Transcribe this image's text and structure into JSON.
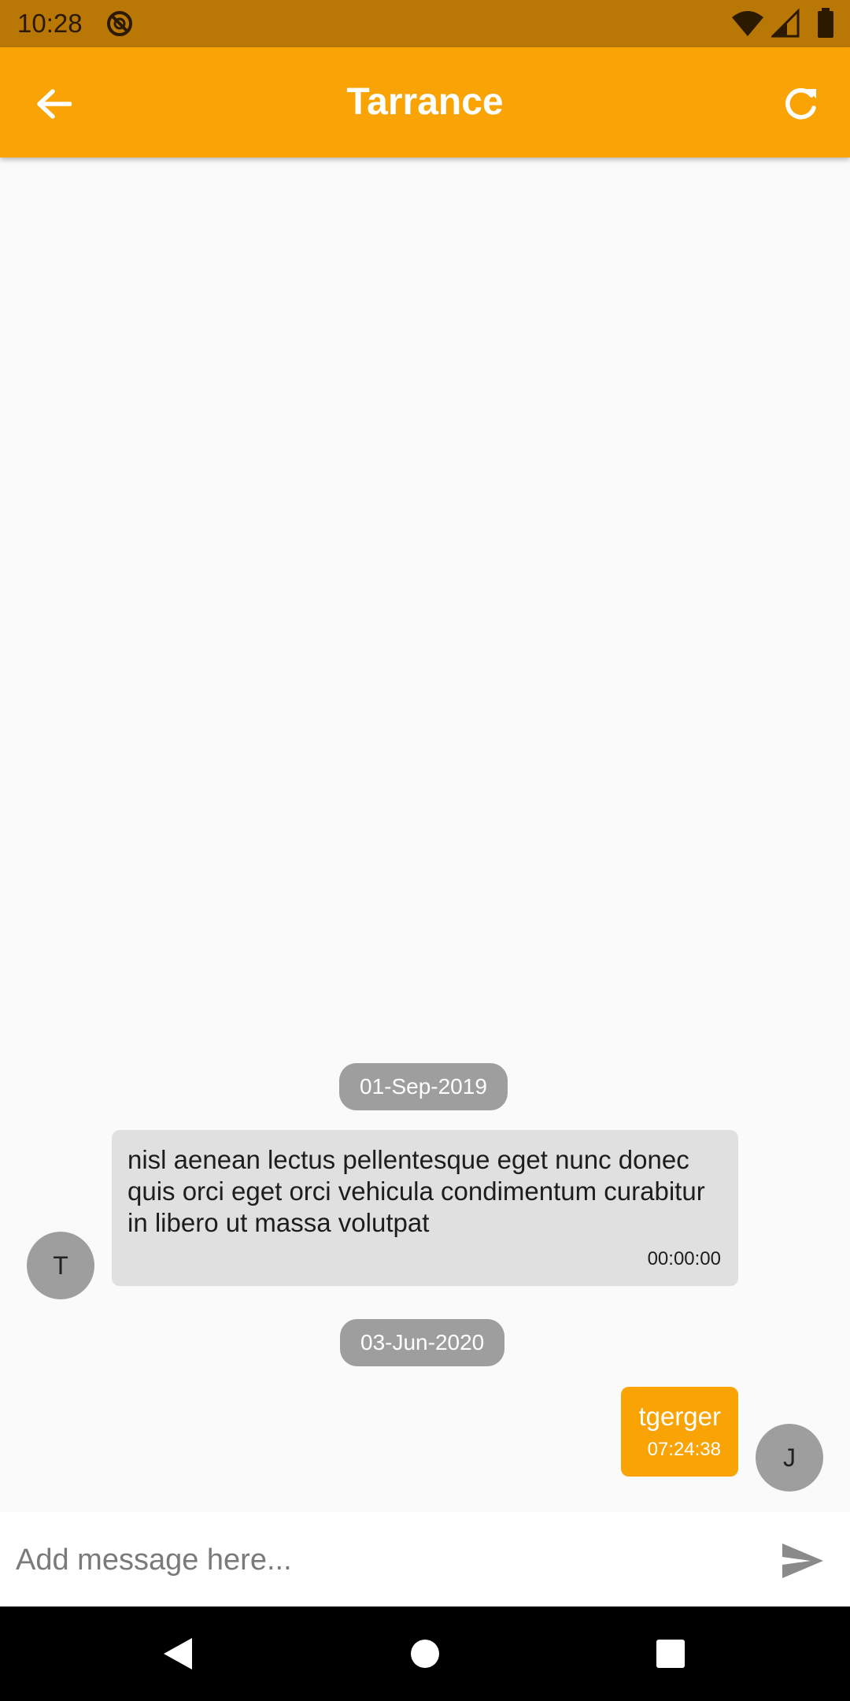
{
  "status_bar": {
    "time": "10:28",
    "icons": [
      "dnd-icon",
      "wifi-icon",
      "cellular-signal-icon",
      "battery-icon"
    ]
  },
  "app_bar": {
    "title": "Tarrance",
    "back_icon": "arrow-back-icon",
    "refresh_icon": "refresh-icon",
    "background": "#f9a305"
  },
  "messages": [
    {
      "date": "01-Sep-2019",
      "direction": "incoming",
      "avatar_initial": "T",
      "text": "nisl aenean lectus pellentesque eget nunc donec quis orci eget orci vehicula condimentum curabitur in libero ut massa volutpat",
      "time": "00:00:00"
    },
    {
      "date": "03-Jun-2020",
      "direction": "outgoing",
      "avatar_initial": "J",
      "text": "tgerger",
      "time": "07:24:38"
    }
  ],
  "composer": {
    "placeholder": "Add message here...",
    "value": "",
    "send_icon": "send-icon"
  },
  "nav_bar": {
    "icons": [
      "back-triangle-icon",
      "home-circle-icon",
      "recents-square-icon"
    ]
  },
  "colors": {
    "accent": "#f9a305",
    "status_bar": "#b97705",
    "chip": "#9e9e9e",
    "incoming_bubble": "#e0e0e0"
  }
}
